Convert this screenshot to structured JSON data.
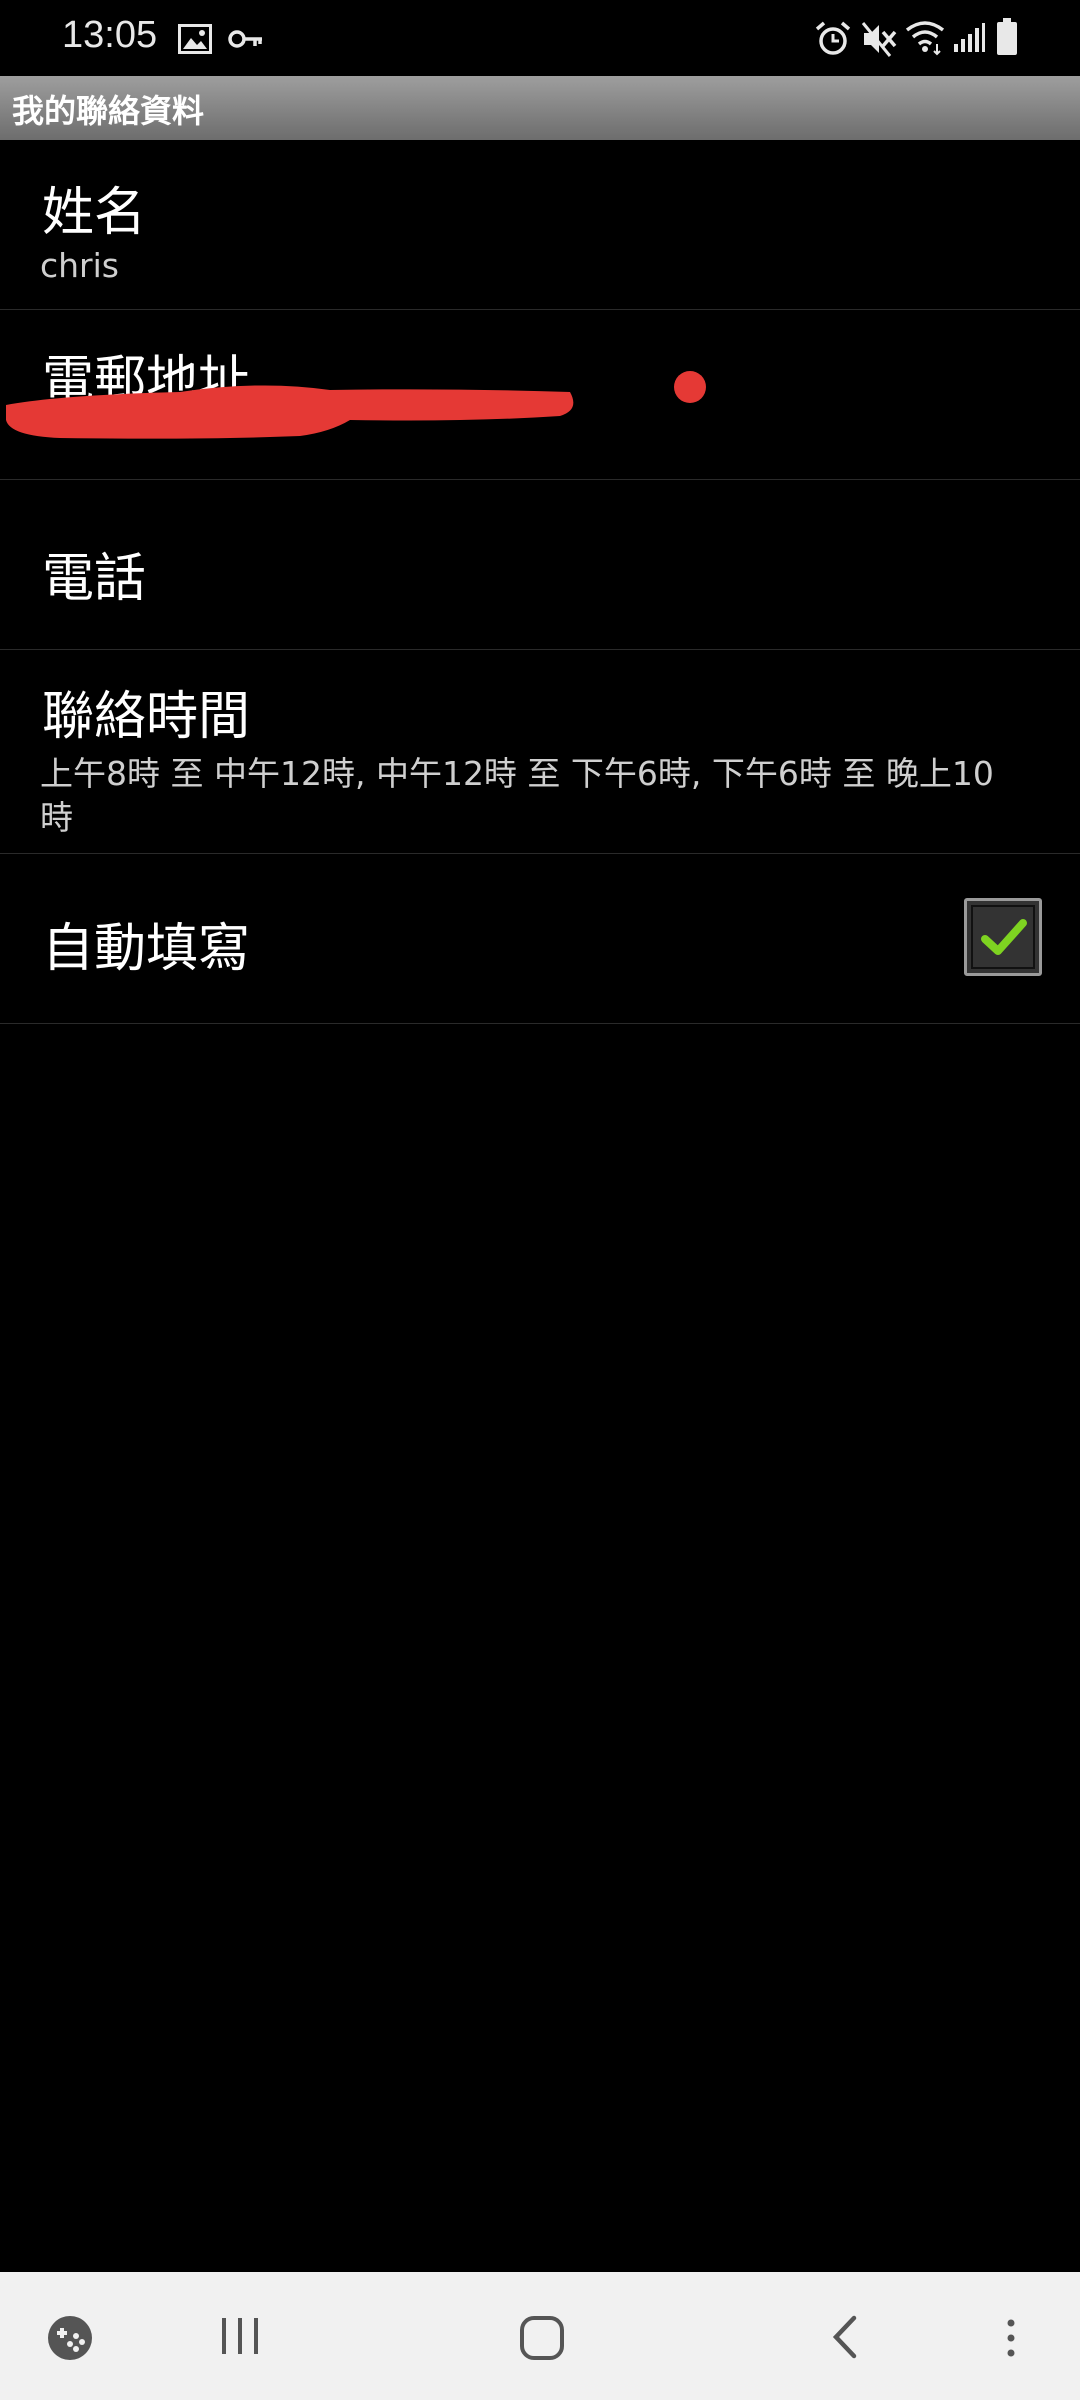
{
  "status_bar": {
    "time": "13:05",
    "icons": [
      "gallery-icon",
      "key-icon",
      "alarm-icon",
      "mute-icon",
      "wifi-icon",
      "signal-icon",
      "battery-icon"
    ]
  },
  "title_bar": {
    "title": "我的聯絡資料"
  },
  "preferences": {
    "name": {
      "title": "姓名",
      "summary": "chris"
    },
    "email": {
      "title": "電郵地址",
      "summary": ""
    },
    "phone": {
      "title": "電話"
    },
    "contact_time": {
      "title": "聯絡時間",
      "summary": "上午8時 至 中午12時, 中午12時 至 下午6時, 下午6時 至 晚上10時"
    },
    "autofill": {
      "title": "自動填寫",
      "checked": true
    }
  },
  "colors": {
    "background": "#000000",
    "title_bar": "#8a8a8a",
    "check_mark": "#7ed321",
    "redaction": "#e53935",
    "nav_bar": "#f1f1f1"
  },
  "nav_bar": {
    "icons": [
      "game-tools-icon",
      "recent-apps-icon",
      "home-icon",
      "back-icon",
      "more-icon"
    ]
  }
}
